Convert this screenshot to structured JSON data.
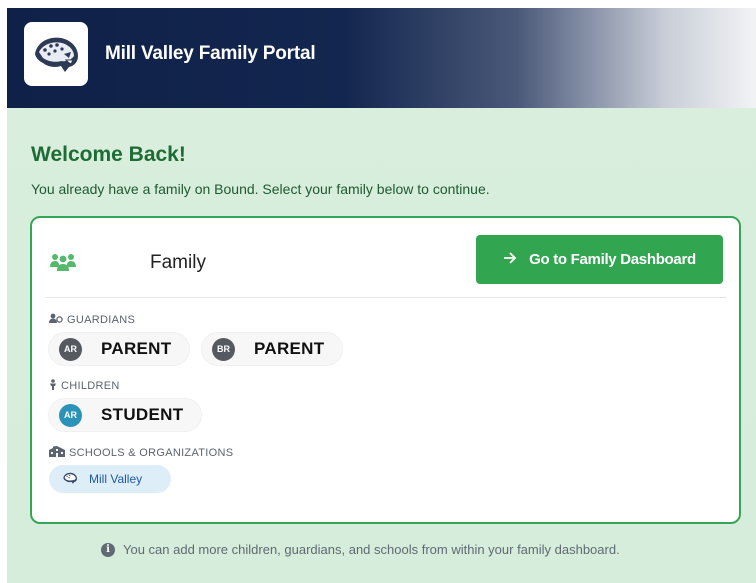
{
  "header": {
    "title": "Mill Valley Family Portal",
    "logo_icon": "jaguar-logo-icon"
  },
  "main": {
    "welcome": "Welcome Back!",
    "subtitle": "You already have a family on Bound. Select your family below to continue."
  },
  "family_card": {
    "family_icon": "family-icon",
    "family_name": "Family",
    "dashboard_button": "Go to Family Dashboard",
    "guardians": {
      "label": "GUARDIANS",
      "items": [
        {
          "initials": "AR",
          "name": "PARENT",
          "color": "#555a60"
        },
        {
          "initials": "BR",
          "name": "PARENT",
          "color": "#555a60"
        }
      ]
    },
    "children": {
      "label": "CHILDREN",
      "items": [
        {
          "initials": "AR",
          "name": "STUDENT",
          "color": "#2b93b8"
        }
      ]
    },
    "schools": {
      "label": "SCHOOLS & ORGANIZATIONS",
      "items": [
        {
          "name": "Mill Valley",
          "icon": "jaguar-logo-icon"
        }
      ]
    }
  },
  "footer_note": "You can add more children, guardians, and schools from within your family dashboard.",
  "colors": {
    "header_dark": "#0f2148",
    "accent_green": "#32a551",
    "heading_green": "#1e6b35",
    "background_mint": "#d9eedd"
  }
}
